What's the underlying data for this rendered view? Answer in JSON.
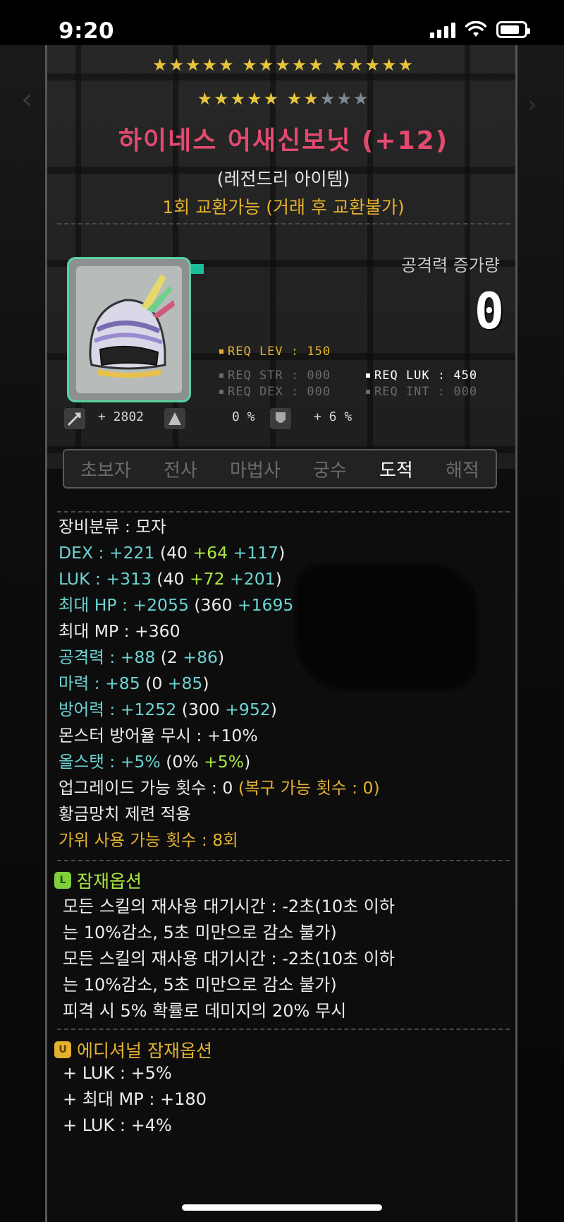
{
  "status_bar": {
    "time": "9:20"
  },
  "item": {
    "stars_row1": "★★★★★ ★★★★★ ★★★★★",
    "stars_row2_gold": "★★★★★ ★★",
    "stars_row2_dim": "★★★",
    "name": "하이네스 어새신보닛 (+12)",
    "grade": "(레전드리 아이템)",
    "trade": "1회 교환가능 (거래 후 교환불가)",
    "atk_label": "공격력 증가량",
    "atk_value": "0",
    "req_lev": "REQ LEV : 150",
    "req_str": "REQ STR : 000",
    "req_dex": "REQ DEX : 000",
    "req_luk": "REQ LUK : 450",
    "req_int": "REQ INT : 000",
    "stat_a": "+ 2802",
    "stat_b": "0 %",
    "stat_c": "+ 6 %"
  },
  "classes": [
    "초보자",
    "전사",
    "마법사",
    "궁수",
    "도적",
    "해적"
  ],
  "active_class_index": 4,
  "stats": {
    "category": "장비분류 : 모자",
    "dex_label": "DEX : +221",
    "dex_base": "(40 ",
    "dex_add1": "+64 ",
    "dex_add2": "+117",
    "dex_close": ")",
    "luk_label": "LUK : +313",
    "luk_base": "(40 ",
    "luk_add1": "+72 ",
    "luk_add2": "+201",
    "luk_close": ")",
    "hp_label": "최대 HP : +2055",
    "hp_base": "(360 ",
    "hp_add1": "+1695",
    "mp": "최대 MP : +360",
    "atk_label": "공격력 : +88",
    "atk_base": "(2 ",
    "atk_add": "+86",
    "atk_close": ")",
    "mag_label": "마력 : +85",
    "mag_base": "(0 ",
    "mag_add": "+85",
    "mag_close": ")",
    "def_label": "방어력 : +1252",
    "def_base": "(300 ",
    "def_add": "+952",
    "def_close": ")",
    "ignore_def": "몬스터 방어율 무시 : +10%",
    "allstat_label": "올스탯 : +5%",
    "allstat_base": "(0% ",
    "allstat_add": "+5%",
    "allstat_close": ")",
    "upgrade": "업그레이드 가능 횟수 : 0",
    "upgrade_restore": "(복구 가능 횟수 : 0)",
    "hammer": "황금망치 제련 적용",
    "scissors": "가위 사용 가능 횟수 : 8회"
  },
  "potential": {
    "header": "잠재옵션",
    "badge": "L",
    "lines": [
      "모든 스킬의 재사용 대기시간 : -2초(10초 이하",
      "는 10%감소, 5초 미만으로 감소 불가)",
      "모든 스킬의 재사용 대기시간 : -2초(10초 이하",
      "는 10%감소, 5초 미만으로 감소 불가)",
      "피격 시 5% 확률로 데미지의 20% 무시"
    ]
  },
  "additional_potential": {
    "header": "에디셔널 잠재옵션",
    "badge": "U",
    "lines": [
      "+ LUK : +5%",
      "+ 최대 MP : +180",
      "+ LUK : +4%"
    ]
  }
}
